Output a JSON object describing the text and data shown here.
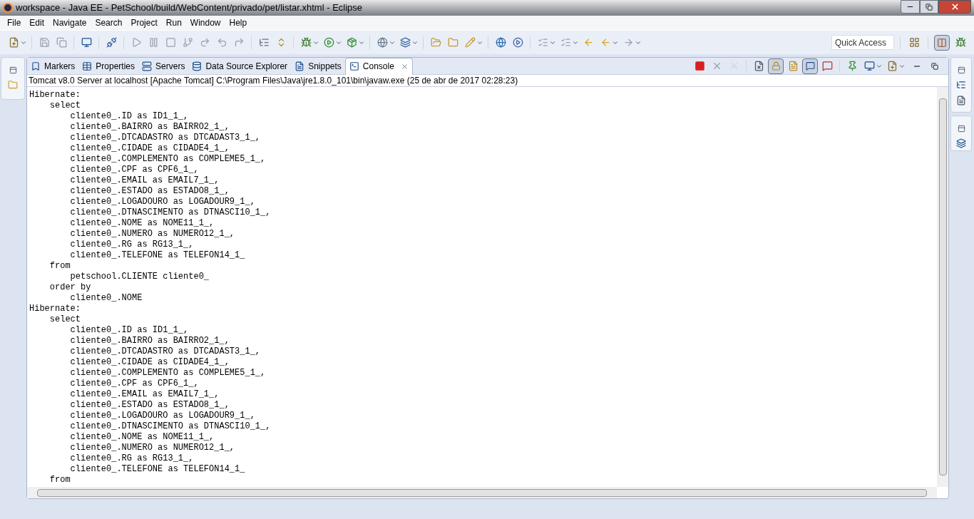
{
  "window": {
    "title": "workspace - Java EE - PetSchool/build/WebContent/privado/pet/listar.xhtml - Eclipse"
  },
  "menu": [
    "File",
    "Edit",
    "Navigate",
    "Search",
    "Project",
    "Run",
    "Window",
    "Help"
  ],
  "quick_access": {
    "placeholder": "Quick Access"
  },
  "tabs": [
    {
      "label": "Markers",
      "selected": false
    },
    {
      "label": "Properties",
      "selected": false
    },
    {
      "label": "Servers",
      "selected": false
    },
    {
      "label": "Data Source Explorer",
      "selected": false
    },
    {
      "label": "Snippets",
      "selected": false
    },
    {
      "label": "Console",
      "selected": true
    }
  ],
  "console": {
    "header": "Tomcat v8.0 Server at localhost [Apache Tomcat] C:\\Program Files\\Java\\jre1.8.0_101\\bin\\javaw.exe (25 de abr de 2017 02:28:23)",
    "lines": [
      "Hibernate:",
      "    select",
      "        cliente0_.ID as ID1_1_,",
      "        cliente0_.BAIRRO as BAIRRO2_1_,",
      "        cliente0_.DTCADASTRO as DTCADAST3_1_,",
      "        cliente0_.CIDADE as CIDADE4_1_,",
      "        cliente0_.COMPLEMENTO as COMPLEME5_1_,",
      "        cliente0_.CPF as CPF6_1_,",
      "        cliente0_.EMAIL as EMAIL7_1_,",
      "        cliente0_.ESTADO as ESTADO8_1_,",
      "        cliente0_.LOGADOURO as LOGADOUR9_1_,",
      "        cliente0_.DTNASCIMENTO as DTNASCI10_1_,",
      "        cliente0_.NOME as NOME11_1_,",
      "        cliente0_.NUMERO as NUMERO12_1_,",
      "        cliente0_.RG as RG13_1_,",
      "        cliente0_.TELEFONE as TELEFON14_1_",
      "    from",
      "        petschool.CLIENTE cliente0_",
      "    order by",
      "        cliente0_.NOME",
      "Hibernate:",
      "    select",
      "        cliente0_.ID as ID1_1_,",
      "        cliente0_.BAIRRO as BAIRRO2_1_,",
      "        cliente0_.DTCADASTRO as DTCADAST3_1_,",
      "        cliente0_.CIDADE as CIDADE4_1_,",
      "        cliente0_.COMPLEMENTO as COMPLEME5_1_,",
      "        cliente0_.CPF as CPF6_1_,",
      "        cliente0_.EMAIL as EMAIL7_1_,",
      "        cliente0_.ESTADO as ESTADO8_1_,",
      "        cliente0_.LOGADOURO as LOGADOUR9_1_,",
      "        cliente0_.DTNASCIMENTO as DTNASCI10_1_,",
      "        cliente0_.NOME as NOME11_1_,",
      "        cliente0_.NUMERO as NUMERO12_1_,",
      "        cliente0_.RG as RG13_1_,",
      "        cliente0_.TELEFONE as TELEFON14_1_",
      "    from"
    ]
  }
}
